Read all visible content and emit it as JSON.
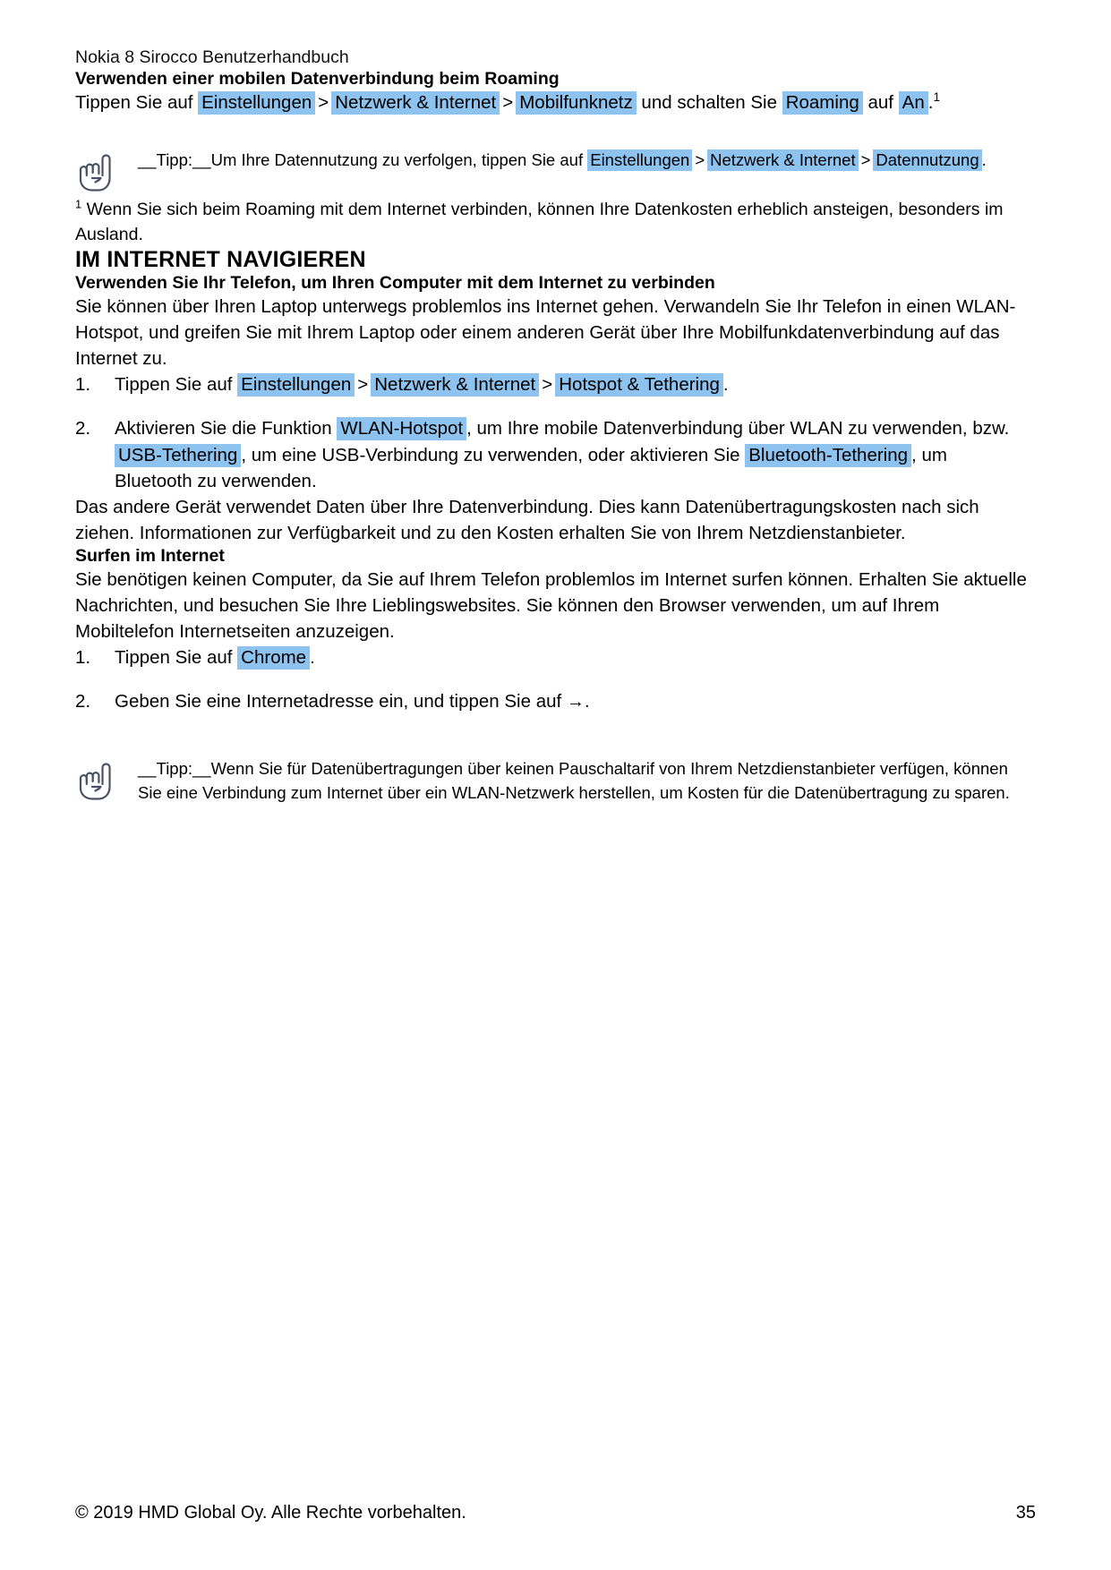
{
  "header": {
    "running_title": "Nokia 8 Sirocco Benutzerhandbuch"
  },
  "roaming_section": {
    "heading": "Verwenden einer mobilen Datenverbindung beim Roaming",
    "instruction": {
      "lead": "Tippen Sie auf",
      "path": [
        "Einstellungen",
        "Netzwerk & Internet",
        "Mobilfunknetz"
      ],
      "separator": ">",
      "middle": "und schalten Sie",
      "toggle_target": "Roaming",
      "connector": "auf",
      "toggle_value": "An",
      "period": ".",
      "footnote_marker": "1"
    },
    "tip": {
      "icon": "pointing-hand-icon",
      "label": "__Tipp:__",
      "text_before": "Um Ihre Datennutzung zu verfolgen, tippen Sie auf",
      "path": [
        "Einstellungen",
        "Netzwerk & Internet",
        "Datennutzung"
      ],
      "separator": ">",
      "period": "."
    },
    "footnote": {
      "marker": "1",
      "text": "Wenn Sie sich beim Roaming mit dem Internet verbinden, können Ihre Datenkosten erheblich ansteigen, besonders im Ausland."
    }
  },
  "internet_section": {
    "title": "IM INTERNET NAVIGIEREN",
    "tethering": {
      "heading": "Verwenden Sie Ihr Telefon, um Ihren Computer mit dem Internet zu verbinden",
      "intro": "Sie können über Ihren Laptop unterwegs problemlos ins Internet gehen. Verwandeln Sie Ihr Telefon in einen WLAN-Hotspot, und greifen Sie mit Ihrem Laptop oder einem anderen Gerät über Ihre Mobilfunkdatenverbindung auf das Internet zu.",
      "steps": [
        {
          "number": "1.",
          "lead": "Tippen Sie auf",
          "path": [
            "Einstellungen",
            "Netzwerk & Internet",
            "Hotspot & Tethering"
          ],
          "separator": ">",
          "period": "."
        },
        {
          "number": "2.",
          "part1": "Aktivieren Sie die Funktion",
          "hl1": "WLAN-Hotspot",
          "part2": ", um Ihre mobile Datenverbindung über WLAN zu verwenden, bzw.",
          "hl2": "USB-Tethering",
          "part3": ", um eine USB-Verbindung zu verwenden, oder aktivieren Sie",
          "hl3": "Bluetooth-Tethering",
          "part4": ", um Bluetooth zu verwenden."
        }
      ],
      "outro": "Das andere Gerät verwendet Daten über Ihre Datenverbindung. Dies kann Datenübertragungskosten nach sich ziehen. Informationen zur Verfügbarkeit und zu den Kosten erhalten Sie von Ihrem Netzdienstanbieter."
    },
    "browsing": {
      "heading": "Surfen im Internet",
      "intro": "Sie benötigen keinen Computer, da Sie auf Ihrem Telefon problemlos im Internet surfen können. Erhalten Sie aktuelle Nachrichten, und besuchen Sie Ihre Lieblingswebsites. Sie können den Browser verwenden, um auf Ihrem Mobiltelefon Internetseiten anzuzeigen.",
      "steps": [
        {
          "number": "1.",
          "lead": "Tippen Sie auf",
          "hl": "Chrome",
          "period": "."
        },
        {
          "number": "2.",
          "text": "Geben Sie eine Internetadresse ein, und tippen Sie auf",
          "arrow": "→",
          "period": "."
        }
      ],
      "tip": {
        "icon": "pointing-hand-icon",
        "label": "__Tipp:__",
        "text": "Wenn Sie für Datenübertragungen über keinen Pauschaltarif von Ihrem Netzdienstanbieter verfügen, können Sie eine Verbindung zum Internet über ein WLAN-Netzwerk herstellen, um Kosten für die Datenübertragung zu sparen."
      }
    }
  },
  "footer": {
    "copyright": "© 2019 HMD Global Oy. Alle Rechte vorbehalten.",
    "page_number": "35"
  },
  "colors": {
    "highlight": "#8ec3ef",
    "text": "#000000",
    "icon_stroke": "#4a5166",
    "background": "#ffffff"
  }
}
